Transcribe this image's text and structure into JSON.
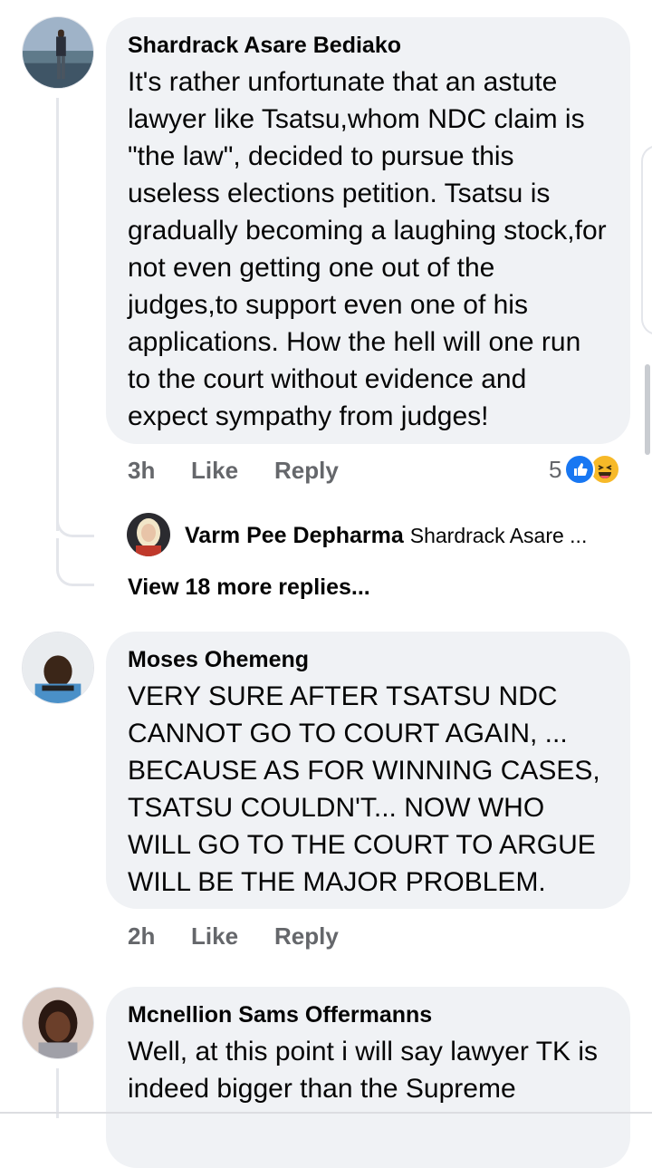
{
  "comments": [
    {
      "author": "Shardrack Asare Bediako",
      "text": "It's rather unfortunate that an astute lawyer like Tsatsu,whom NDC claim is \"the law\", decided to pursue this useless elections petition. Tsatsu is gradually becoming a laughing stock,for not even getting one out of the judges,to support even one of his applications. How the hell will one run to the court without evidence and expect sympathy from judges!",
      "time": "3h",
      "like": "Like",
      "reply": "Reply",
      "reaction_count": "5",
      "reply_preview": {
        "author": "Varm Pee Depharma",
        "snippet": "Shardrack Asare ..."
      },
      "view_more": "View 18 more replies..."
    },
    {
      "author": "Moses Ohemeng",
      "text": "VERY SURE AFTER TSATSU NDC CANNOT GO TO COURT AGAIN, ... BECAUSE AS FOR WINNING CASES, TSATSU COULDN'T... NOW WHO WILL GO TO THE COURT TO ARGUE WILL BE THE MAJOR PROBLEM.",
      "time": "2h",
      "like": "Like",
      "reply": "Reply"
    },
    {
      "author": "Mcnellion Sams Offermanns",
      "text": "Well, at this point i will say lawyer TK is indeed bigger than the Supreme"
    }
  ],
  "colors": {
    "bubble": "#f0f2f5",
    "meta": "#65676b",
    "like_blue": "#1877f2",
    "haha_yellow": "#f7b928"
  }
}
